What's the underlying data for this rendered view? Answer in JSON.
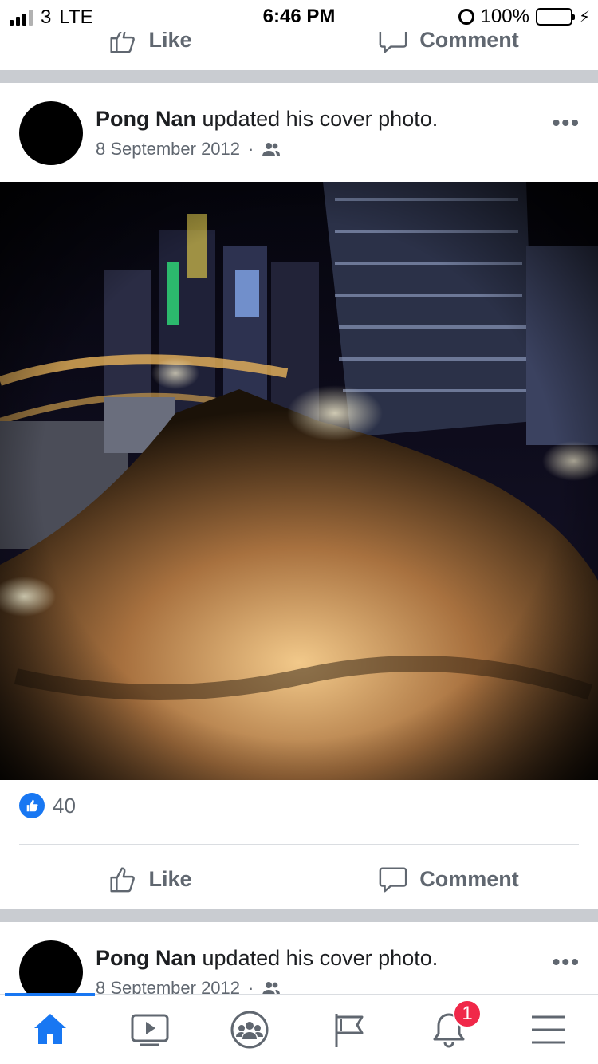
{
  "status": {
    "carrier": "3",
    "network": "LTE",
    "time": "6:46 PM",
    "battery": "100%"
  },
  "actions": {
    "like_label": "Like",
    "comment_label": "Comment"
  },
  "posts": [
    {
      "author": "Pong Nan",
      "text": "updated his cover photo.",
      "date": "8 September 2012",
      "privacy_icon": "friends-icon",
      "likes": "40"
    },
    {
      "author": "Pong Nan",
      "text": "updated his cover photo.",
      "date": "8 September 2012",
      "privacy_icon": "friends-icon"
    }
  ],
  "tabs": [
    {
      "icon": "home-icon",
      "active": true
    },
    {
      "icon": "watch-icon"
    },
    {
      "icon": "groups-icon"
    },
    {
      "icon": "pages-flag-icon"
    },
    {
      "icon": "notifications-icon",
      "badge": "1"
    },
    {
      "icon": "menu-icon"
    }
  ],
  "colors": {
    "accent": "#1877f2",
    "badge": "#f02849",
    "separator": "#c9ccd1"
  }
}
